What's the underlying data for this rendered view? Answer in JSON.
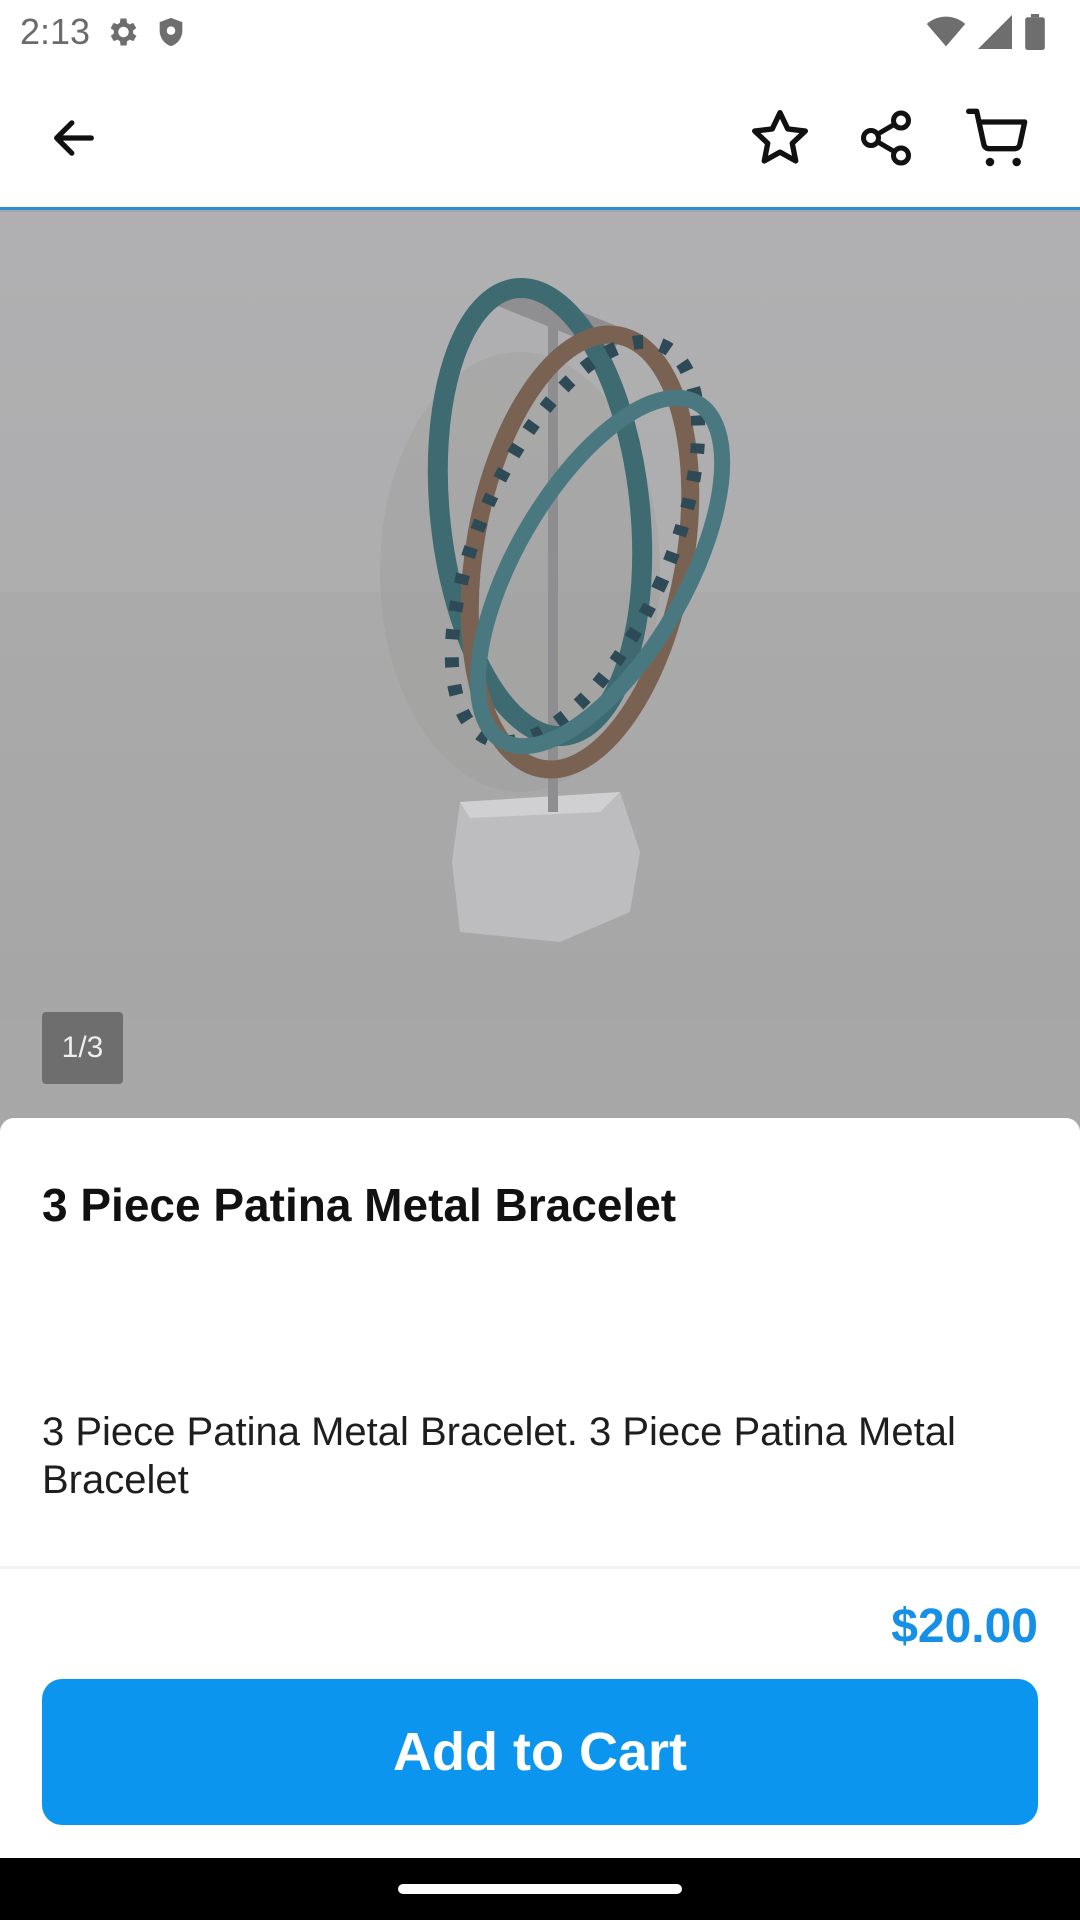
{
  "status_bar": {
    "time": "2:13",
    "icons": [
      "gear-icon",
      "shield-icon",
      "wifi-icon",
      "signal-icon",
      "battery-icon"
    ]
  },
  "app_bar": {
    "icons": [
      "back-arrow-icon",
      "star-icon",
      "share-icon",
      "cart-icon"
    ]
  },
  "gallery": {
    "page_indicator": "1/3"
  },
  "product": {
    "title": "3 Piece Patina Metal Bracelet",
    "description": "3 Piece Patina Metal Bracelet. 3 Piece Patina Metal Bracelet",
    "price": "$20.00"
  },
  "actions": {
    "add_to_cart_label": "Add to Cart"
  },
  "colors": {
    "accent": "#0c95ee",
    "price": "#1590e6",
    "divider": "#2a8ed4"
  }
}
